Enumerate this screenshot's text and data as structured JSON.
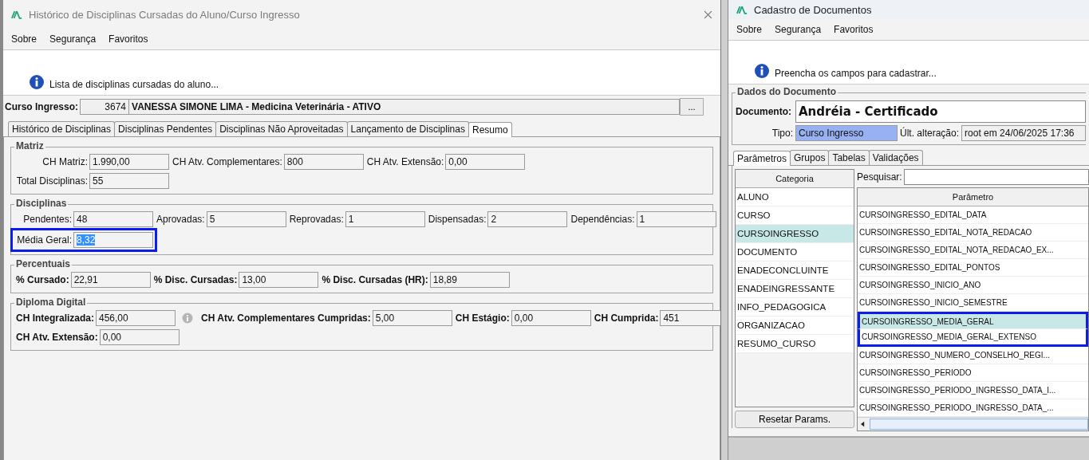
{
  "left_window": {
    "title": "Histórico de Disciplinas Cursadas do Aluno/Curso Ingresso",
    "menu": [
      "Sobre",
      "Segurança",
      "Favoritos"
    ],
    "info": "Lista de disciplinas cursadas do aluno...",
    "curso_ingresso": {
      "label": "Curso Ingresso:",
      "code": "3674",
      "name": "VANESSA SIMONE LIMA - Medicina Veterinária - ATIVO",
      "button": "..."
    },
    "tabs": [
      {
        "label": "Histórico de Disciplinas",
        "selected": false
      },
      {
        "label": "Disciplinas Pendentes",
        "selected": false
      },
      {
        "label": "Disciplinas Não Aproveitadas",
        "selected": false
      },
      {
        "label": "Lançamento de Disciplinas",
        "selected": false
      },
      {
        "label": "Resumo",
        "selected": true
      }
    ],
    "groups": [
      {
        "title": "Matriz",
        "bold_labels": false,
        "rows": [
          [
            {
              "label": "CH Matriz:",
              "value": "1.990,00"
            },
            {
              "label": "CH Atv. Complementares:",
              "value": "800"
            },
            {
              "label": "CH Atv. Extensão:",
              "value": "0,00"
            }
          ],
          [
            {
              "label": "Total Disciplinas:",
              "value": "55"
            }
          ]
        ]
      },
      {
        "title": "Disciplinas",
        "bold_labels": false,
        "rows": [
          [
            {
              "label": "Pendentes:",
              "value": "48"
            },
            {
              "label": "Aprovadas:",
              "value": "5"
            },
            {
              "label": "Reprovadas:",
              "value": "1"
            },
            {
              "label": "Dispensadas:",
              "value": "2"
            },
            {
              "label": "Dependências:",
              "value": "1"
            }
          ],
          [
            {
              "label": "Média Geral:",
              "value": "8,32",
              "annotated": true,
              "text_selected": true
            }
          ]
        ]
      },
      {
        "title": "Percentuais",
        "bold_labels": true,
        "rows": [
          [
            {
              "label": "% Cursado:",
              "value": "22,91"
            },
            {
              "label": "% Disc. Cursadas:",
              "value": "13,00"
            },
            {
              "label": "% Disc. Cursadas (HR):",
              "value": "18,89"
            }
          ]
        ]
      },
      {
        "title": "Diploma Digital",
        "bold_labels": true,
        "rows": [
          [
            {
              "label": "CH Integralizada:",
              "value": "456,00",
              "info_icon": true
            },
            {
              "label": "CH Atv. Complementares Cumpridas:",
              "value": "5,00"
            },
            {
              "label": "CH Estágio:",
              "value": "0,00"
            },
            {
              "label": "CH Cumprida:",
              "value": "451"
            }
          ],
          [
            {
              "label": "CH Atv. Extensão:",
              "value": "0,00"
            }
          ]
        ]
      }
    ]
  },
  "right_window": {
    "title": "Cadastro de Documentos",
    "menu": [
      "Sobre",
      "Segurança",
      "Favoritos"
    ],
    "info": "Preencha os campos para cadastrar...",
    "dados": {
      "title": "Dados do Documento",
      "documento_label": "Documento:",
      "documento": "Andréia - Certificado",
      "tipo_label": "Tipo:",
      "tipo": "Curso Ingresso",
      "tipo_highlighted": true,
      "alteracao_label": "Últ. alteração:",
      "alteracao": "root em 24/06/2025 17:36"
    },
    "tabs": [
      {
        "label": "Parâmetros",
        "selected": true
      },
      {
        "label": "Grupos",
        "selected": false
      },
      {
        "label": "Tabelas",
        "selected": false
      },
      {
        "label": "Validações",
        "selected": false
      }
    ],
    "categoria": {
      "header": "Categoria",
      "items": [
        {
          "label": "ALUNO",
          "selected": false
        },
        {
          "label": "CURSO",
          "selected": false
        },
        {
          "label": "CURSOINGRESSO",
          "selected": true
        },
        {
          "label": "DOCUMENTO",
          "selected": false
        },
        {
          "label": "ENADECONCLUINTE",
          "selected": false
        },
        {
          "label": "ENADEINGRESSANTE",
          "selected": false
        },
        {
          "label": "INFO_PEDAGOGICA",
          "selected": false
        },
        {
          "label": "ORGANIZACAO",
          "selected": false
        },
        {
          "label": "RESUMO_CURSO",
          "selected": false
        }
      ],
      "button": "Resetar Params."
    },
    "search_label": "Pesquisar:",
    "parametro": {
      "header": "Parâmetro",
      "rows": [
        {
          "label": "CURSOINGRESSO_EDITAL_DATA",
          "selected": false,
          "annotated": false
        },
        {
          "label": "CURSOINGRESSO_EDITAL_NOTA_REDACAO",
          "selected": false,
          "annotated": false
        },
        {
          "label": "CURSOINGRESSO_EDITAL_NOTA_REDACAO_EX...",
          "selected": false,
          "annotated": false
        },
        {
          "label": "CURSOINGRESSO_EDITAL_PONTOS",
          "selected": false,
          "annotated": false
        },
        {
          "label": "CURSOINGRESSO_INICIO_ANO",
          "selected": false,
          "annotated": false
        },
        {
          "label": "CURSOINGRESSO_INICIO_SEMESTRE",
          "selected": false,
          "annotated": false
        },
        {
          "label": "CURSOINGRESSO_MEDIA_GERAL",
          "selected": true,
          "annotated": true
        },
        {
          "label": "CURSOINGRESSO_MEDIA_GERAL_EXTENSO",
          "selected": false,
          "annotated": true
        },
        {
          "label": "CURSOINGRESSO_NUMERO_CONSELHO_REGI...",
          "selected": false,
          "annotated": false
        },
        {
          "label": "CURSOINGRESSO_PERIODO",
          "selected": false,
          "annotated": false
        },
        {
          "label": "CURSOINGRESSO_PERIODO_INGRESSO_DATA_I...",
          "selected": false,
          "annotated": false
        },
        {
          "label": "CURSOINGRESSO_PERIODO_INGRESSO_DATA_...",
          "selected": false,
          "annotated": false
        }
      ]
    }
  }
}
